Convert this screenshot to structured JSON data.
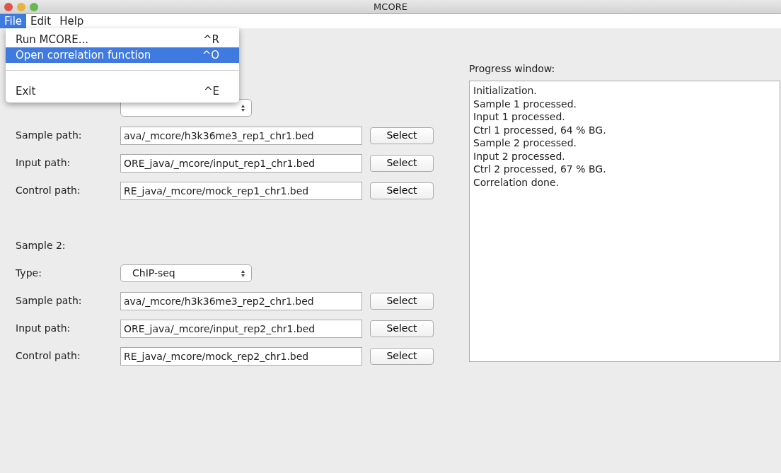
{
  "window": {
    "title": "MCORE"
  },
  "menubar": [
    {
      "label": "File",
      "selected": true
    },
    {
      "label": "Edit",
      "selected": false
    },
    {
      "label": "Help",
      "selected": false
    }
  ],
  "menu": [
    {
      "kind": "item",
      "label": "Run MCORE...",
      "shortcut": "^R",
      "selected": false
    },
    {
      "kind": "item",
      "label": "Open correlation function",
      "shortcut": "^O",
      "selected": true
    },
    {
      "kind": "separator"
    },
    {
      "kind": "item",
      "label": "Exit",
      "shortcut": "^E",
      "selected": false
    }
  ],
  "samples": [
    {
      "rows": [
        {
          "label": "Sample path:",
          "value": "ava/_mcore/h3k36me3_rep1_chr1.bed",
          "button": "Select"
        },
        {
          "label": "Input path:",
          "value": "ORE_java/_mcore/input_rep1_chr1.bed",
          "button": "Select"
        },
        {
          "label": "Control path:",
          "value": "RE_java/_mcore/mock_rep1_chr1.bed",
          "button": "Select"
        }
      ]
    },
    {
      "title": "Sample 2:",
      "type": {
        "label": "Type:",
        "value": "ChIP-seq"
      },
      "rows": [
        {
          "label": "Sample path:",
          "value": "ava/_mcore/h3k36me3_rep2_chr1.bed",
          "button": "Select"
        },
        {
          "label": "Input path:",
          "value": "ORE_java/_mcore/input_rep2_chr1.bed",
          "button": "Select"
        },
        {
          "label": "Control path:",
          "value": "RE_java/_mcore/mock_rep2_chr1.bed",
          "button": "Select"
        }
      ]
    }
  ],
  "progress": {
    "label": "Progress window:",
    "lines": [
      "Initialization.",
      "Sample 1 processed.",
      "Input 1 processed.",
      "Ctrl 1 processed, 64 % BG.",
      "Sample 2 processed.",
      "Input 2 processed.",
      "Ctrl 2 processed, 67 % BG.",
      "Correlation done."
    ]
  }
}
